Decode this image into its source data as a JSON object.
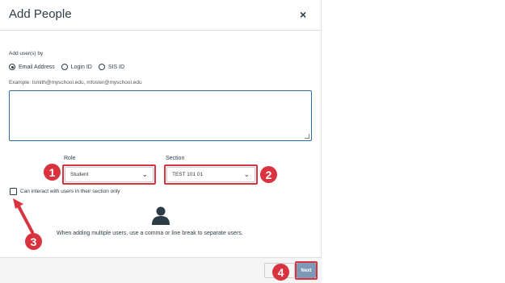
{
  "dialog": {
    "title": "Add People",
    "close_glyph": "×"
  },
  "form": {
    "add_by_label": "Add user(s) by",
    "options": [
      {
        "label": "Email Address",
        "selected": true
      },
      {
        "label": "Login ID",
        "selected": false
      },
      {
        "label": "SIS ID",
        "selected": false
      }
    ],
    "example_hint": "Example: lsmith@myschool.edu, mfoster@myschool.edu",
    "textarea_value": "",
    "role_label": "Role",
    "role_value": "Student",
    "section_label": "Section",
    "section_value": "TEST 101 01",
    "checkbox_label": "Can interact with users in their section only",
    "checkbox_checked": false,
    "help_text": "When adding multiple users, use a comma or line break to separate users."
  },
  "footer": {
    "cancel_label": "C",
    "next_label": "Next"
  },
  "annotations": {
    "badges": [
      "1",
      "2",
      "3",
      "4"
    ],
    "highlight_color": "#d9333f"
  },
  "icons": {
    "dropdown": "chevron-down-icon",
    "user": "user-icon",
    "close": "close-icon"
  }
}
